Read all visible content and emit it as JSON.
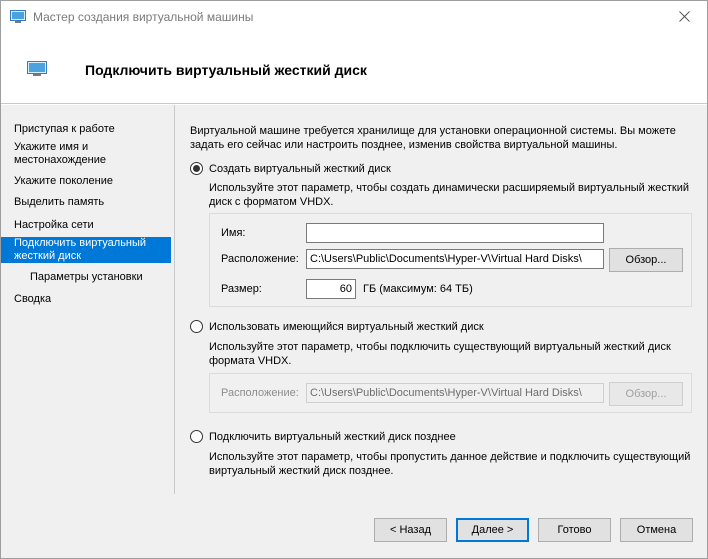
{
  "window": {
    "title": "Мастер создания виртуальной машины",
    "close_icon": "close-icon"
  },
  "header": {
    "title": "Подключить виртуальный жесткий диск"
  },
  "nav": {
    "items": [
      {
        "label": "Приступая к работе",
        "active": false
      },
      {
        "label": "Укажите имя и местонахождение",
        "active": false
      },
      {
        "label": "Укажите поколение",
        "active": false
      },
      {
        "label": "Выделить память",
        "active": false
      },
      {
        "label": "Настройка сети",
        "active": false
      },
      {
        "label": "Подключить виртуальный жесткий диск",
        "active": true
      },
      {
        "label": "Параметры установки",
        "active": false
      },
      {
        "label": "Сводка",
        "active": false
      }
    ]
  },
  "main": {
    "description": "Виртуальной машине требуется хранилище для установки операционной системы. Вы можете задать его сейчас или настроить позднее, изменив свойства виртуальной машины.",
    "option_create": {
      "label": "Создать виртуальный жесткий диск",
      "checked": true,
      "description": "Используйте этот параметр, чтобы создать динамически расширяемый виртуальный жесткий диск с форматом VHDX.",
      "name_label": "Имя:",
      "name_value": "",
      "location_label": "Расположение:",
      "location_value": "C:\\Users\\Public\\Documents\\Hyper-V\\Virtual Hard Disks\\",
      "browse_label": "Обзор...",
      "size_label": "Размер:",
      "size_value": "60",
      "size_unit": "ГБ (максимум: 64 ТБ)"
    },
    "option_existing": {
      "label": "Использовать имеющийся виртуальный жесткий диск",
      "checked": false,
      "description": "Используйте этот параметр, чтобы подключить существующий виртуальный жесткий диск формата VHDX.",
      "location_label": "Расположение:",
      "location_value": "C:\\Users\\Public\\Documents\\Hyper-V\\Virtual Hard Disks\\",
      "browse_label": "Обзор..."
    },
    "option_later": {
      "label": "Подключить виртуальный жесткий диск позднее",
      "checked": false,
      "description": "Используйте этот параметр, чтобы пропустить данное действие и подключить существующий виртуальный жесткий диск позднее."
    }
  },
  "footer": {
    "back_label": "< Назад",
    "next_label": "Далее >",
    "finish_label": "Готово",
    "cancel_label": "Отмена"
  },
  "colors": {
    "accent": "#0078d7",
    "panel": "#f0f0f0"
  }
}
